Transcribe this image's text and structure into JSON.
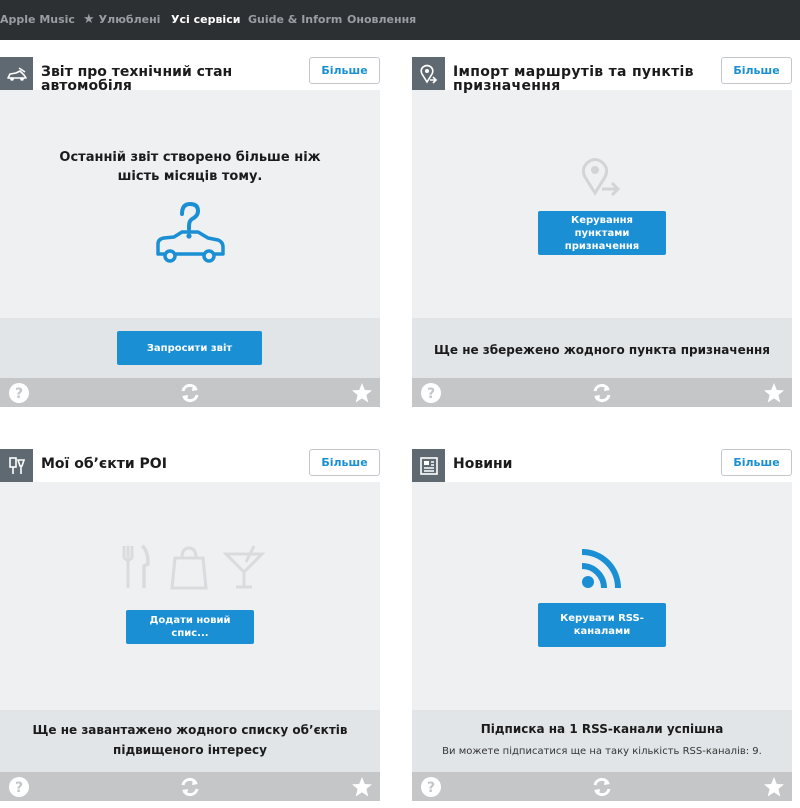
{
  "nav": {
    "items": [
      {
        "label": "Apple Music",
        "active": false
      },
      {
        "label": "Улюблені",
        "active": false,
        "icon": "star-icon"
      },
      {
        "label": "Усі сервіси",
        "active": true
      },
      {
        "label": "Guide & Inform",
        "active": false
      },
      {
        "label": "Оновлення",
        "active": false
      }
    ]
  },
  "common": {
    "more_label": "Більше"
  },
  "cards": {
    "vehicle": {
      "title": "Звіт про технічний стан автомобіля",
      "icon": "car-wrench-icon",
      "message": "Останній звіт створено більше ніж шість місяців тому.",
      "button": "Запросити звіт"
    },
    "import": {
      "title": "Імпорт маршрутів та пунктів призначення",
      "icon": "location-pin-icon",
      "button": "Керування пунктами призначення",
      "status": "Ще не збережено жодного пункта призначення"
    },
    "poi": {
      "title": "Мої об’єкти POI",
      "icon": "poi-icon",
      "button": "Додати новий спис...",
      "status": "Ще не завантажено жодного списку об’єктів підвищеного інтересу"
    },
    "news": {
      "title": "Новини",
      "icon": "news-icon",
      "button": "Керувати RSS-каналами",
      "status": "Підписка на 1 RSS-канали успішна",
      "substatus": "Ви можете підписатися ще на таку кількість RSS-каналів: 9."
    }
  },
  "colors": {
    "accent": "#1a8fd4",
    "nav_bg": "#2d3033",
    "card_bg": "#eef0f2",
    "footer_bar": "#c4c6c8"
  }
}
